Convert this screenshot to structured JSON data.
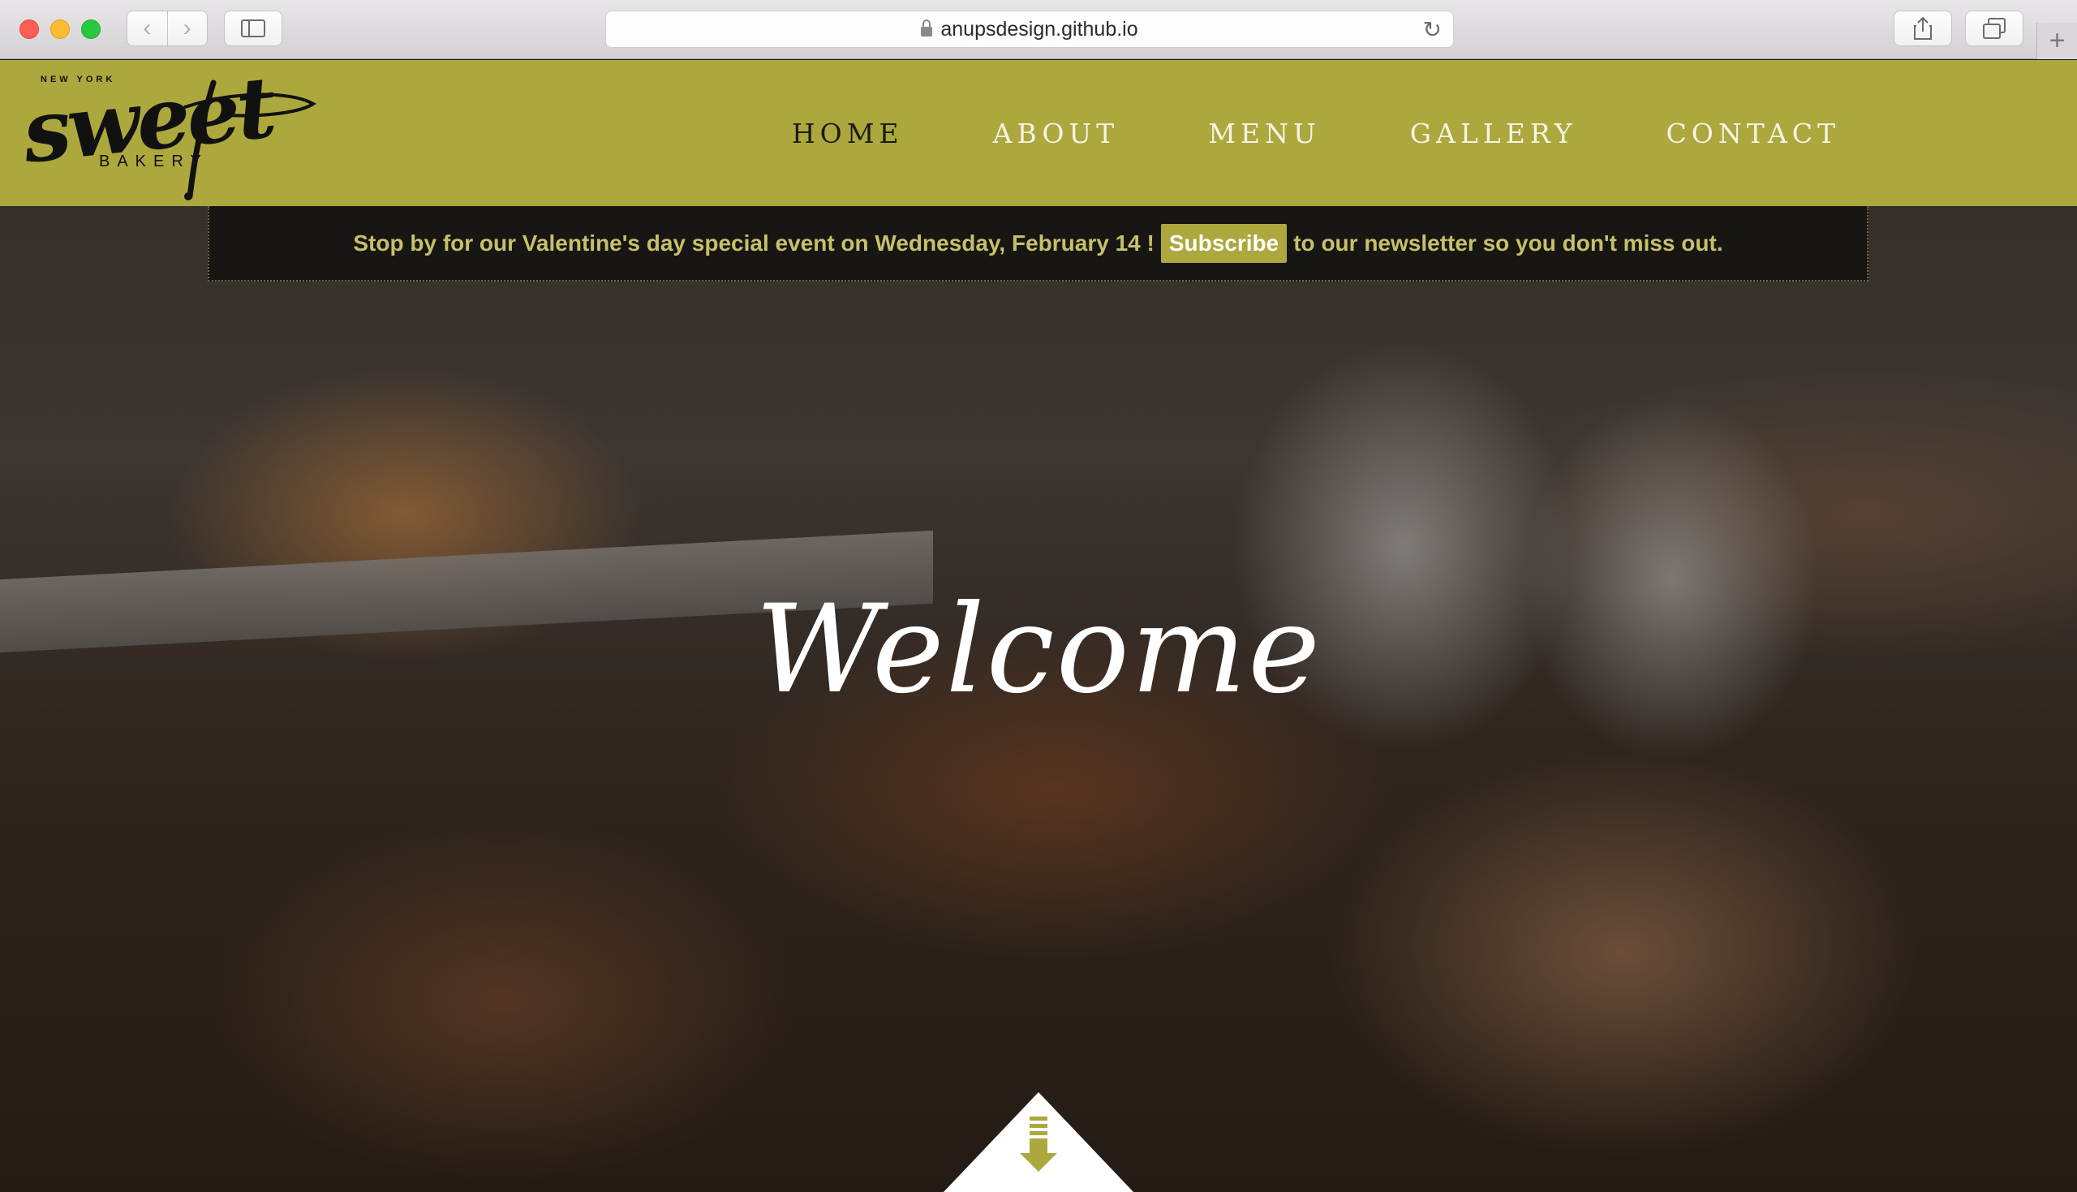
{
  "browser": {
    "url": "anupsdesign.github.io"
  },
  "site": {
    "logo": {
      "top": "NEW YORK",
      "main": "sweet",
      "bottom": "BAKERY"
    },
    "nav": [
      "HOME",
      "ABOUT",
      "MENU",
      "GALLERY",
      "CONTACT"
    ],
    "active_nav": "HOME",
    "banner": {
      "before": "Stop by for our Valentine's day special event on Wednesday, February 14 !",
      "link": "Subscribe",
      "after": "to our newsletter so you don't miss out."
    },
    "hero_title": "Welcome"
  },
  "colors": {
    "brand": "#aca83d",
    "banner_bg": "#171612",
    "banner_text": "#c7c06a"
  },
  "icons": {
    "scroll_down": "arrow-down-icon"
  }
}
